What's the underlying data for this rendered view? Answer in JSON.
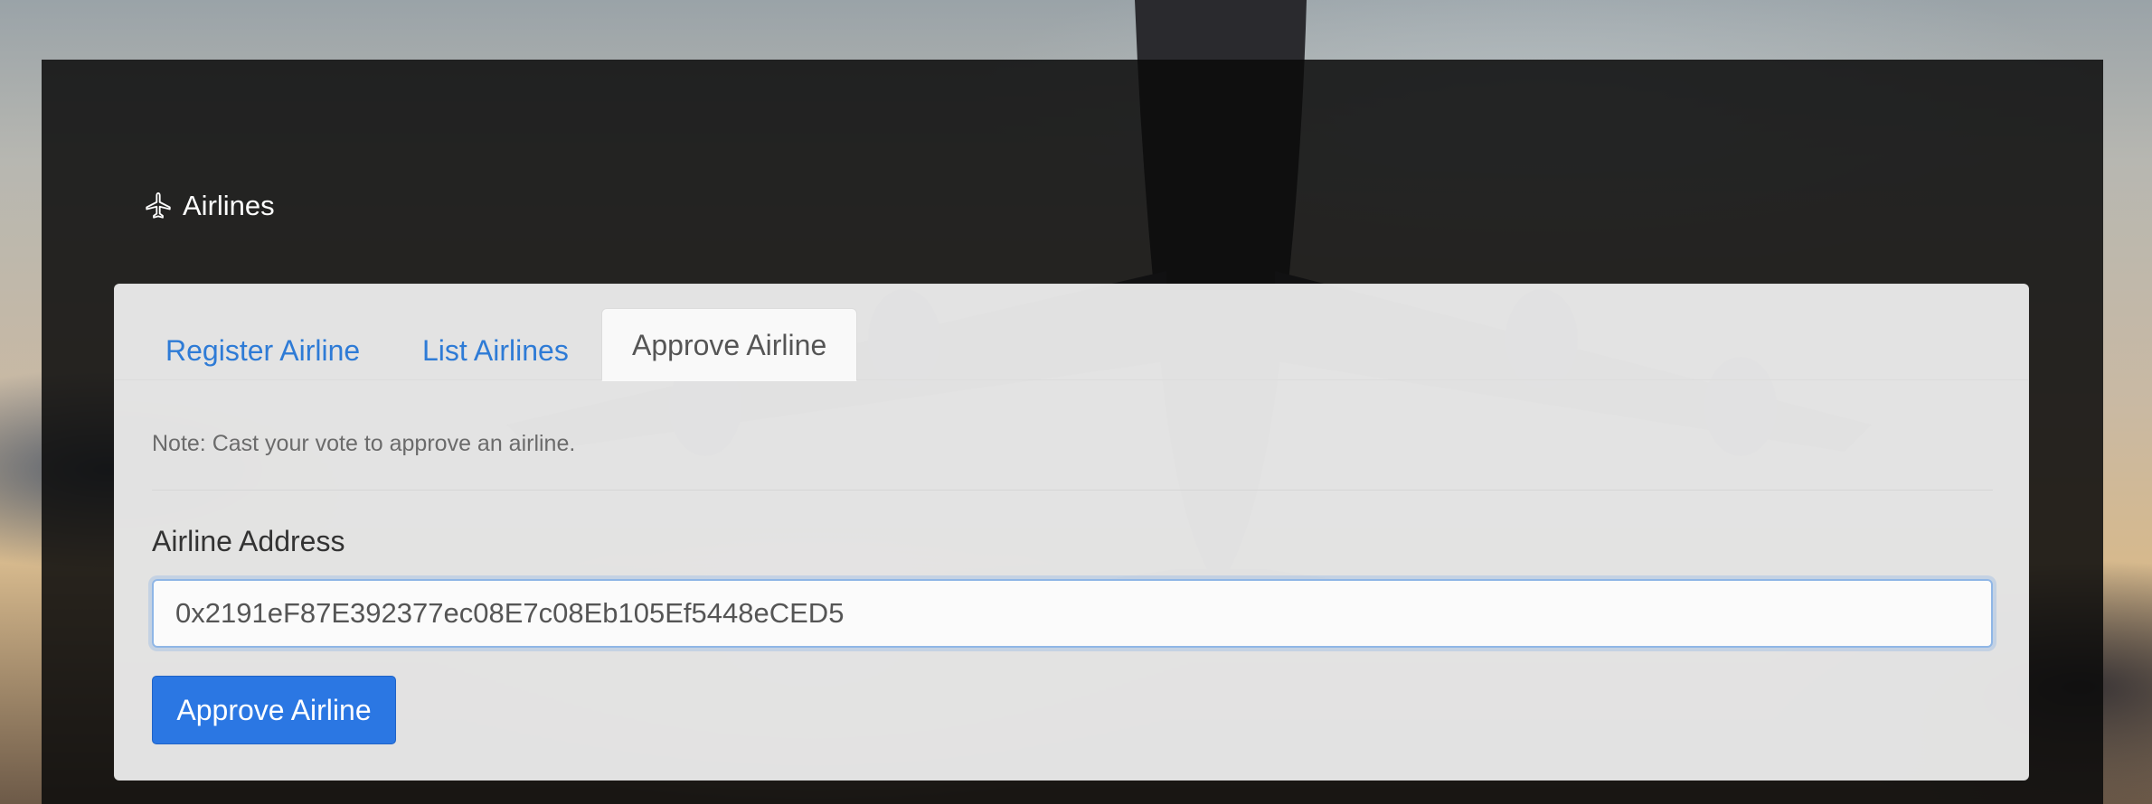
{
  "brand": {
    "icon": "airplane-icon",
    "title": "Airlines"
  },
  "tabs": [
    {
      "label": "Register Airline",
      "active": false
    },
    {
      "label": "List Airlines",
      "active": false
    },
    {
      "label": "Approve Airline",
      "active": true
    }
  ],
  "approve_form": {
    "note": "Note: Cast your vote to approve an airline.",
    "address_label": "Airline Address",
    "address_value": "0x2191eF87E392377ec08E7c08Eb105Ef5448eCED5",
    "submit_label": "Approve Airline"
  },
  "colors": {
    "link": "#2e7bd6",
    "primary_button": "#2b77e3",
    "panel_dark": "#0a0a0a"
  }
}
